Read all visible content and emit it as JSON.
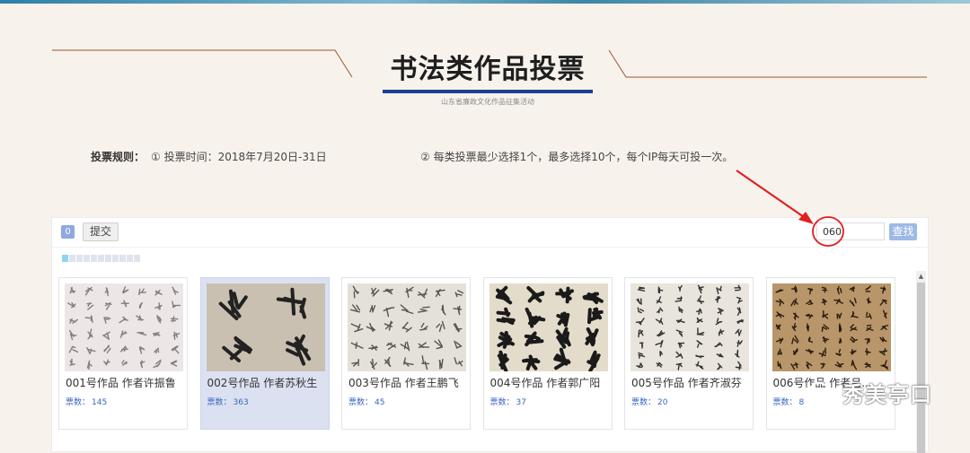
{
  "header": {
    "title": "书法类作品投票",
    "subtitle": "山东省廉政文化作品征集活动"
  },
  "rules": {
    "label": "投票规则：",
    "rule1": "① 投票时间：2018年7月20日-31日",
    "rule2": "② 每类投票最少选择1个，最多选择10个，每个IP每天可投一次。"
  },
  "toolbar": {
    "selected_count": "0",
    "submit_label": "提交",
    "search_value": "060",
    "search_button_label": "查找"
  },
  "pager": {
    "page_count": 11,
    "active_page": 1
  },
  "cards": [
    {
      "name": "001号作品 作者许振鲁",
      "votes_label": "票数：",
      "votes": "145",
      "selected": false
    },
    {
      "name": "002号作品 作者苏秋生",
      "votes_label": "票数：",
      "votes": "363",
      "selected": true
    },
    {
      "name": "003号作品 作者王鹏飞",
      "votes_label": "票数：",
      "votes": "45",
      "selected": false
    },
    {
      "name": "004号作品 作者郭广阳",
      "votes_label": "票数：",
      "votes": "37",
      "selected": false
    },
    {
      "name": "005号作品 作者齐淑芬",
      "votes_label": "票数：",
      "votes": "20",
      "selected": false
    },
    {
      "name": "006号作品 作者吕...",
      "votes_label": "票数：",
      "votes": "8",
      "selected": false
    }
  ],
  "watermark": {
    "text": "秀美亭口",
    "icon": "wechat-icon"
  },
  "colors": {
    "accent": "#1f3f8f",
    "annotation": "#e02020",
    "search_button": "#9db9e6",
    "selected_card": "#dbe1f1",
    "vote_text": "#3a66c2"
  }
}
